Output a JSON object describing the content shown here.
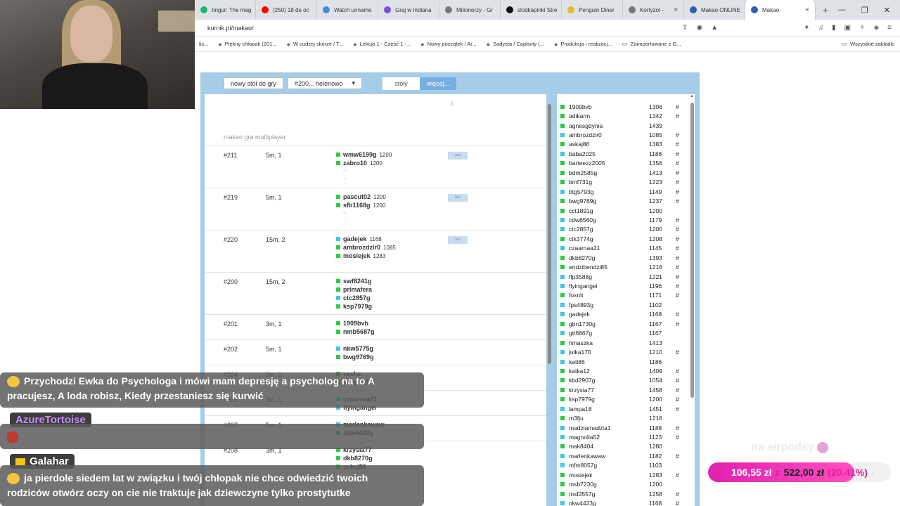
{
  "browser": {
    "tabs": [
      {
        "label": "Imgur: The mag",
        "color": "#1bb76e"
      },
      {
        "label": "(250) 18 de oc",
        "color": "#ff0000"
      },
      {
        "label": "Watch unname",
        "color": "#3d8bd9"
      },
      {
        "label": "Graj w Indiana",
        "color": "#7b4fd9"
      },
      {
        "label": "Milionerzy - Gr",
        "color": "#777777"
      },
      {
        "label": "slodkapinki Stre",
        "color": "#111111"
      },
      {
        "label": "Penguin Diner",
        "color": "#e8b923"
      },
      {
        "label": "Kortyzol -",
        "color": "#777777"
      },
      {
        "label": "Makao ONLINE",
        "color": "#2d5fb0"
      },
      {
        "label": "Makao",
        "color": "#2d5fb0",
        "active": true
      }
    ],
    "url": "kurnik.pl/makao/",
    "bookmarks": [
      "lis...",
      "Piękny chłopak (201...",
      "W cudzej skórze / T...",
      "Lekcja 1 - Część 1 -...",
      "Nowy początek / Ar...",
      "Sadysta / Captivity (...",
      "Produkcja i realizacj...",
      "Zaimportowane z G..."
    ],
    "bookmarks_right": "Wszystkie zakładki"
  },
  "game": {
    "new_table_button": "nowy stół do gry",
    "room_select": "#200... helenowo",
    "seg_tables": "stoły",
    "seg_more": "więcej...",
    "close": "x",
    "title": "makao gra multiplayer",
    "go_label": ">>",
    "tables": [
      {
        "num": "#211",
        "time": "5m, 1",
        "players": [
          {
            "name": "wmw6199g",
            "rating": "1200",
            "color": "#2ecc40"
          },
          {
            "name": "zabro10",
            "rating": "1200",
            "color": "#2ecc40"
          }
        ],
        "dashes": 2,
        "go": true
      },
      {
        "num": "#219",
        "time": "5m, 1",
        "players": [
          {
            "name": "pascut02",
            "rating": "1200",
            "color": "#2ecc40"
          },
          {
            "name": "sfb1168g",
            "rating": "1200",
            "color": "#2ecc40"
          }
        ],
        "dashes": 2,
        "go": true
      },
      {
        "num": "#220",
        "time": "15m, 2",
        "players": [
          {
            "name": "gadejek",
            "rating": "1168",
            "color": "#3fc8e8"
          },
          {
            "name": "ambrozdzir0",
            "rating": "1085",
            "color": "#2ecc40"
          },
          {
            "name": "mosiejek",
            "rating": "1283",
            "color": "#2ecc40"
          }
        ],
        "dashes": 1,
        "go": true
      },
      {
        "num": "#200",
        "time": "15m, 2",
        "players": [
          {
            "name": "swf8241g",
            "rating": "",
            "color": "#2ecc40"
          },
          {
            "name": "primafera",
            "rating": "",
            "color": "#2ecc40"
          },
          {
            "name": "ctc2857g",
            "rating": "",
            "color": "#3fc8e8"
          },
          {
            "name": "ksp7979g",
            "rating": "",
            "color": "#2ecc40"
          }
        ],
        "dashes": 0,
        "go": false
      },
      {
        "num": "#201",
        "time": "3m, 1",
        "players": [
          {
            "name": "1909bvb",
            "rating": "",
            "color": "#2ecc40"
          },
          {
            "name": "nmb5687g",
            "rating": "",
            "color": "#2ecc40"
          }
        ],
        "dashes": 0,
        "go": false
      },
      {
        "num": "#202",
        "time": "5m, 1",
        "players": [
          {
            "name": "nkw5775g",
            "rating": "",
            "color": "#3fc8e8"
          },
          {
            "name": "bwg9769g",
            "rating": "",
            "color": "#2ecc40"
          }
        ],
        "dashes": 0,
        "go": false
      },
      {
        "num": "#204",
        "time": "3m, 1",
        "players": [
          {
            "name": "veska",
            "rating": "",
            "color": "#2ecc40"
          },
          {
            "name": "lampa18",
            "rating": "",
            "color": "#2ecc40"
          }
        ],
        "dashes": 0,
        "go": false
      },
      {
        "num": "#205",
        "time": "3m, 1",
        "players": [
          {
            "name": "czaarnaa21",
            "rating": "",
            "color": "#3fc8e8"
          },
          {
            "name": "flyingangel",
            "rating": "",
            "color": "#3fc8e8"
          }
        ],
        "dashes": 0,
        "go": false
      },
      {
        "num": "#207",
        "time": "5m, 1",
        "players": [
          {
            "name": "marlenkawaw",
            "rating": "",
            "color": "#3fc8e8"
          },
          {
            "name": "nkw4423g",
            "rating": "",
            "color": "#2ecc40"
          }
        ],
        "dashes": 0,
        "go": false
      },
      {
        "num": "#208",
        "time": "3m, 1",
        "players": [
          {
            "name": "krzysia77",
            "rating": "",
            "color": "#2ecc40"
          },
          {
            "name": "dkb8270g",
            "rating": "",
            "color": "#2ecc40"
          },
          {
            "name": "askaj86",
            "rating": "",
            "color": "#2ecc40"
          }
        ],
        "dashes": 0,
        "go": false
      }
    ],
    "users": [
      {
        "name": "1909bvb",
        "rating": "1306",
        "mark": "#",
        "color": "#2ecc40"
      },
      {
        "name": "adikarm",
        "rating": "1342",
        "mark": "#",
        "color": "#2ecc40"
      },
      {
        "name": "agnesgdynia",
        "rating": "1439",
        "mark": "",
        "color": "#2ecc40"
      },
      {
        "name": "ambrozdzir0",
        "rating": "1085",
        "mark": "#",
        "color": "#3fc8e8"
      },
      {
        "name": "askaj86",
        "rating": "1383",
        "mark": "#",
        "color": "#2ecc40"
      },
      {
        "name": "baba2025",
        "rating": "1188",
        "mark": "#",
        "color": "#3fc8e8"
      },
      {
        "name": "barteezz2005",
        "rating": "1356",
        "mark": "#",
        "color": "#2ecc40"
      },
      {
        "name": "bdm2585g",
        "rating": "1413",
        "mark": "#",
        "color": "#2ecc40"
      },
      {
        "name": "bmf731g",
        "rating": "1223",
        "mark": "#",
        "color": "#2ecc40"
      },
      {
        "name": "btg5793g",
        "rating": "1149",
        "mark": "#",
        "color": "#3fc8e8"
      },
      {
        "name": "bwg9769g",
        "rating": "1237",
        "mark": "#",
        "color": "#2ecc40"
      },
      {
        "name": "cct1891g",
        "rating": "1200",
        "mark": "",
        "color": "#2ecc40"
      },
      {
        "name": "cdw6560g",
        "rating": "1179",
        "mark": "#",
        "color": "#3fc8e8"
      },
      {
        "name": "ctc2857g",
        "rating": "1200",
        "mark": "#",
        "color": "#3fc8e8"
      },
      {
        "name": "ctk3774g",
        "rating": "1208",
        "mark": "#",
        "color": "#2ecc40"
      },
      {
        "name": "czaarnaa21",
        "rating": "1145",
        "mark": "#",
        "color": "#3fc8e8"
      },
      {
        "name": "dkb8270g",
        "rating": "1393",
        "mark": "#",
        "color": "#2ecc40"
      },
      {
        "name": "endzibendzi85",
        "rating": "1216",
        "mark": "#",
        "color": "#2ecc40"
      },
      {
        "name": "ffp3588g",
        "rating": "1221",
        "mark": "#",
        "color": "#3fc8e8"
      },
      {
        "name": "flyingangel",
        "rating": "1196",
        "mark": "#",
        "color": "#3fc8e8"
      },
      {
        "name": "foxnit",
        "rating": "1171",
        "mark": "#",
        "color": "#2ecc40"
      },
      {
        "name": "fps4893g",
        "rating": "1102",
        "mark": "",
        "color": "#3fc8e8"
      },
      {
        "name": "gadejek",
        "rating": "1168",
        "mark": "#",
        "color": "#3fc8e8"
      },
      {
        "name": "gbn1730g",
        "rating": "1167",
        "mark": "#",
        "color": "#2ecc40"
      },
      {
        "name": "gtt6867g",
        "rating": "1167",
        "mark": "",
        "color": "#3fc8e8"
      },
      {
        "name": "hmaszka",
        "rating": "1413",
        "mark": "",
        "color": "#2ecc40"
      },
      {
        "name": "julka170",
        "rating": "1210",
        "mark": "#",
        "color": "#3fc8e8"
      },
      {
        "name": "kati86",
        "rating": "1186",
        "mark": "",
        "color": "#3fc8e8"
      },
      {
        "name": "katka12",
        "rating": "1409",
        "mark": "#",
        "color": "#2ecc40"
      },
      {
        "name": "kbd2907g",
        "rating": "1054",
        "mark": "#",
        "color": "#2ecc40"
      },
      {
        "name": "krzysia77",
        "rating": "1458",
        "mark": "#",
        "color": "#2ecc40"
      },
      {
        "name": "ksp7979g",
        "rating": "1200",
        "mark": "#",
        "color": "#2ecc40"
      },
      {
        "name": "lampa18",
        "rating": "1451",
        "mark": "#",
        "color": "#3fc8e8"
      },
      {
        "name": "m3fju",
        "rating": "1216",
        "mark": "",
        "color": "#2ecc40"
      },
      {
        "name": "madziamadzia1",
        "rating": "1188",
        "mark": "#",
        "color": "#3fc8e8"
      },
      {
        "name": "magnolia52",
        "rating": "1123",
        "mark": "#",
        "color": "#3fc8e8"
      },
      {
        "name": "mak8404",
        "rating": "1280",
        "mark": "",
        "color": "#2ecc40"
      },
      {
        "name": "marlenkawaw",
        "rating": "1182",
        "mark": "#",
        "color": "#3fc8e8"
      },
      {
        "name": "mfm8057g",
        "rating": "1103",
        "mark": "",
        "color": "#3fc8e8"
      },
      {
        "name": "mosiejek",
        "rating": "1283",
        "mark": "#",
        "color": "#2ecc40"
      },
      {
        "name": "msb7230g",
        "rating": "1200",
        "mark": "",
        "color": "#2ecc40"
      },
      {
        "name": "msf2557g",
        "rating": "1258",
        "mark": "#",
        "color": "#2ecc40"
      },
      {
        "name": "nkw4423g",
        "rating": "1168",
        "mark": "#",
        "color": "#3fc8e8"
      }
    ]
  },
  "chat": {
    "msg1_line1": "Przychodzi Ewka do Psychologa i mówi mam depresję a psycholog na to A",
    "msg1_line2": "pracujesz, A loda robisz, Kiedy przestaniesz się kurwić",
    "user2": "AzureTortoise",
    "user3": "Galahar",
    "msg3_line1": "ja pierdole siedem lat w związku i twój chłopak nie chce odwiedzić twoich",
    "msg3_line2": "rodziców otwórz oczy on cie nie traktuje jak dziewczyne tylko prostytutke"
  },
  "stream": {
    "airpods": "na airpodsy",
    "goal_current": "106,55 zł",
    "goal_sep": "z",
    "goal_target": "522,00 zł",
    "goal_percent_label": "(20.41%)",
    "goal_fraction": 0.2041
  }
}
